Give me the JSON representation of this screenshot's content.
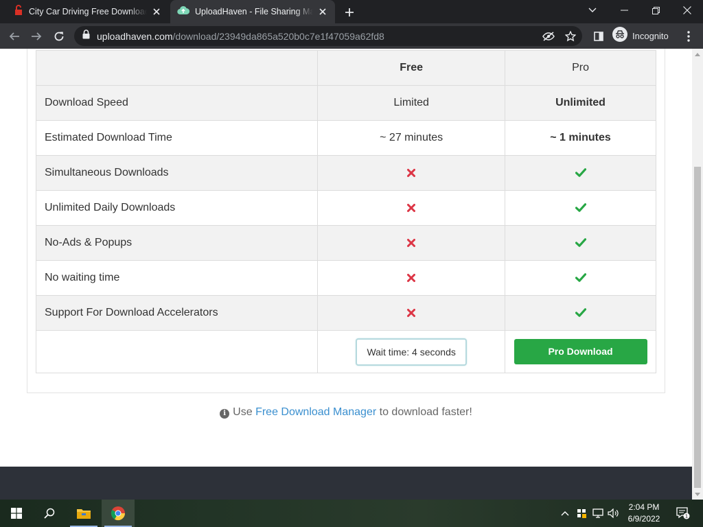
{
  "browser": {
    "tabs": [
      {
        "title": "City Car Driving Free Download (",
        "active": false
      },
      {
        "title": "UploadHaven - File Sharing Made",
        "active": true
      }
    ],
    "url_host": "uploadhaven.com",
    "url_path": "/download/23949da865a520b0c7e1f47059a62fd8",
    "incognito_label": "Incognito"
  },
  "table": {
    "header": {
      "feature": "",
      "free": "Free",
      "pro": "Pro"
    },
    "rows": [
      {
        "feature": "Download Speed",
        "free": "Limited",
        "pro": "Unlimited"
      },
      {
        "feature": "Estimated Download Time",
        "free": "~ 27 minutes",
        "pro": "~ 1 minutes"
      },
      {
        "feature": "Simultaneous Downloads",
        "free": "cross-icon",
        "pro": "check-icon"
      },
      {
        "feature": "Unlimited Daily Downloads",
        "free": "cross-icon",
        "pro": "check-icon"
      },
      {
        "feature": "No-Ads & Popups",
        "free": "cross-icon",
        "pro": "check-icon"
      },
      {
        "feature": "No waiting time",
        "free": "cross-icon",
        "pro": "check-icon"
      },
      {
        "feature": "Support For Download Accelerators",
        "free": "cross-icon",
        "pro": "check-icon"
      }
    ],
    "wait_button": "Wait time: 4 seconds",
    "pro_button": "Pro Download"
  },
  "notice": {
    "prefix": "Use",
    "link": "Free Download Manager",
    "suffix": "to download faster!"
  },
  "taskbar": {
    "time": "2:04 PM",
    "date": "6/9/2022",
    "notification_count": "1"
  },
  "colors": {
    "accent_green": "#28a745",
    "cross_red": "#dc3545",
    "link_blue": "#3a8fcf",
    "footer": "#2d3139"
  }
}
